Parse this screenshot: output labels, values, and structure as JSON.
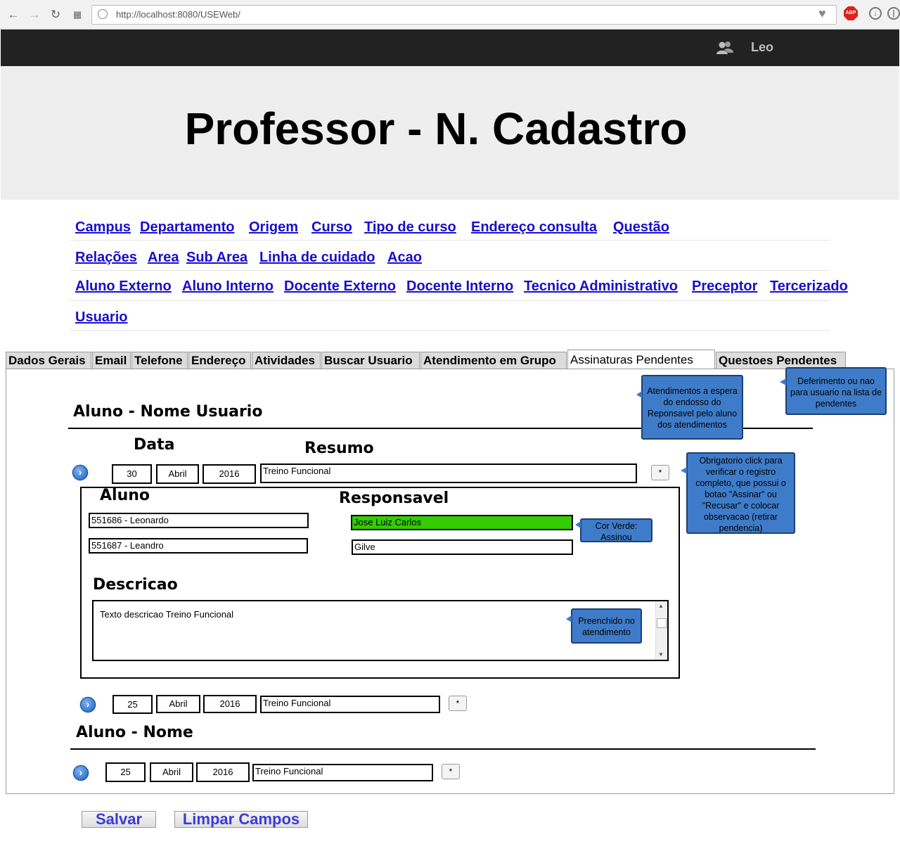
{
  "browser": {
    "url": "http://localhost:8080/USEWeb/"
  },
  "topbar": {
    "user_name": "Leo"
  },
  "header": {
    "title": "Professor - N. Cadastro"
  },
  "menu": {
    "row1": [
      "Campus",
      "Departamento",
      "Origem",
      "Curso",
      "Tipo de curso",
      "Endereço consulta",
      "Questão"
    ],
    "row2": [
      "Relações",
      "Area",
      "Sub Area",
      "Linha de cuidado",
      "Acao"
    ],
    "row3": [
      "Aluno Externo",
      "Aluno Interno",
      "Docente Externo",
      "Docente Interno",
      "Tecnico Administrativo",
      "Preceptor",
      "Tercerizado"
    ],
    "row4": [
      "Usuario"
    ]
  },
  "tabs": [
    "Dados Gerais",
    "Email",
    "Telefone",
    "Endereço",
    "Atividades",
    "Buscar Usuario",
    "Atendimento em Grupo",
    "Assinaturas Pendentes",
    "Questoes Pendentes"
  ],
  "active_tab": "Assinaturas Pendentes",
  "section1": {
    "heading": "Aluno - Nome Usuario",
    "col_data": "Data",
    "col_resumo": "Resumo",
    "record1": {
      "day": "30",
      "month": "Abril",
      "year": "2016",
      "resumo": "Treino Funcional",
      "button": "*",
      "aluno_label": "Aluno",
      "responsavel_label": "Responsavel",
      "alunos": [
        "551686 - Leonardo",
        "551687 - Leandro"
      ],
      "responsaveis": [
        "Jose Luiz Carlos",
        "Gilve"
      ],
      "descricao_label": "Descricao",
      "descricao": "Texto descricao Treino Funcional"
    },
    "record2": {
      "day": "25",
      "month": "Abril",
      "year": "2016",
      "resumo": "Treino Funcional",
      "button": "*"
    }
  },
  "section2": {
    "heading": "Aluno - Nome",
    "record1": {
      "day": "25",
      "month": "Abril",
      "year": "2016",
      "resumo": "Treino Funcional",
      "button": "*"
    }
  },
  "callouts": {
    "pending": "Atendimentos a espera do endosso do Reponsavel pelo aluno dos atendimentos",
    "deferimento": "Deferimento ou nao para usuario na lista de pendentes",
    "obrigatorio": "Obrigatorio click para verificar o registro completo, que possui o botao \"Assinar\" ou \"Recusar\" e colocar observacao (retirar pendencia)",
    "cor_verde": "Cor Verde: Assinou",
    "preenchido": "Preenchido no atendimento"
  },
  "buttons": {
    "save": "Salvar",
    "clear": "Limpar Campos"
  },
  "colors": {
    "signed": "#33cc00",
    "callout": "#3e7cc9",
    "link": "#1a0dcc",
    "topbar": "#222222"
  }
}
